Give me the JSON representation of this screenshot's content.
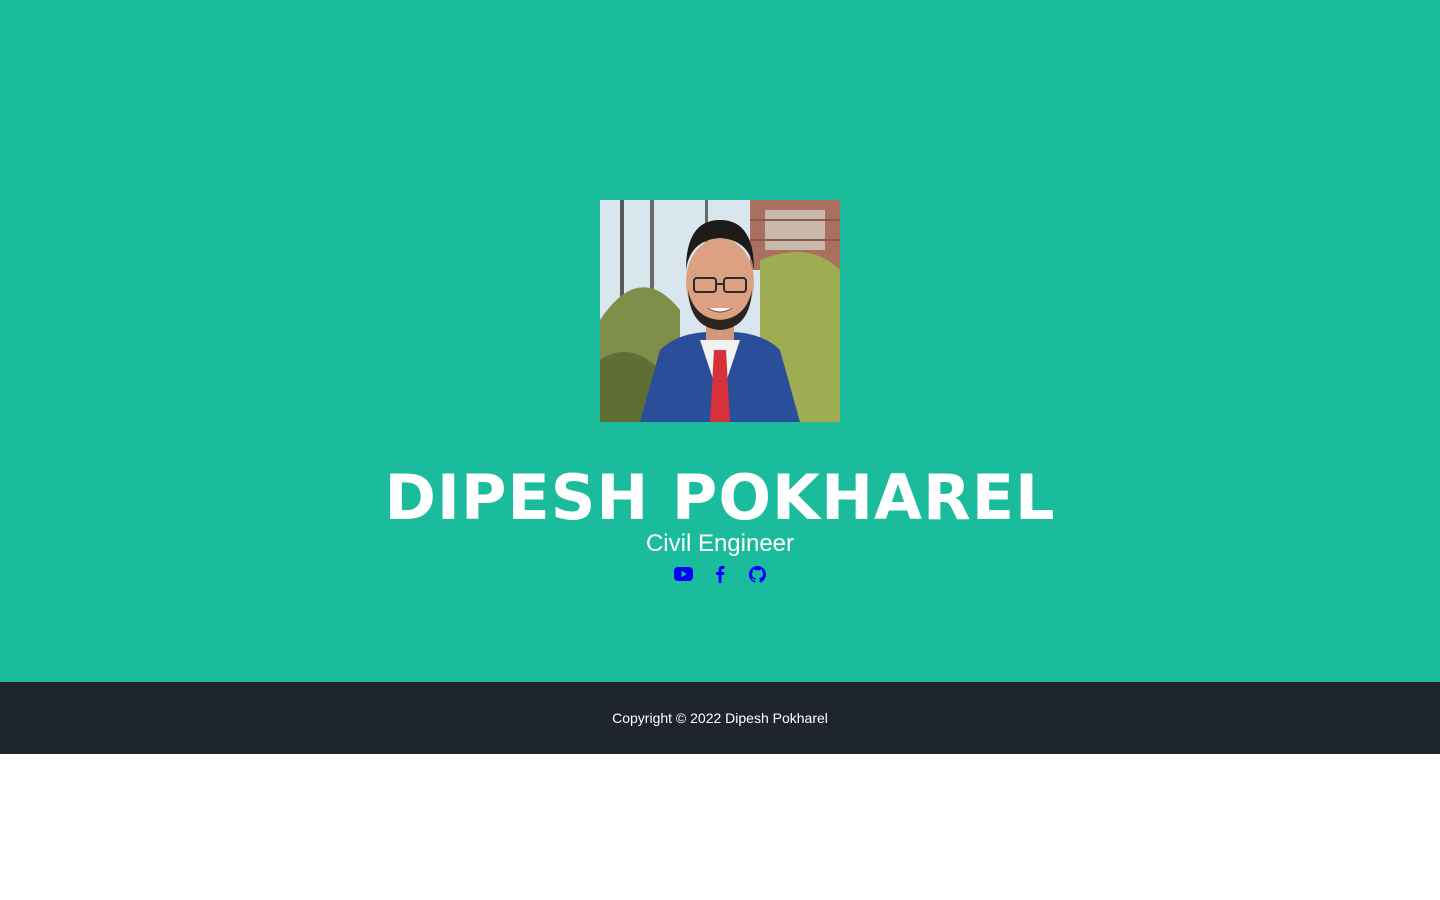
{
  "colors": {
    "masthead_bg": "#1abc9c",
    "footer_bg": "#1e252f",
    "text": "#ffffff",
    "icon_link": "#0000ff"
  },
  "profile": {
    "name": "DIPESH POKHAREL",
    "subtitle": "Civil Engineer",
    "photo_icon": "profile-photo"
  },
  "social": [
    {
      "icon": "youtube-icon"
    },
    {
      "icon": "facebook-icon"
    },
    {
      "icon": "github-icon"
    }
  ],
  "footer": {
    "copyright": "Copyright © 2022 Dipesh Pokharel"
  }
}
